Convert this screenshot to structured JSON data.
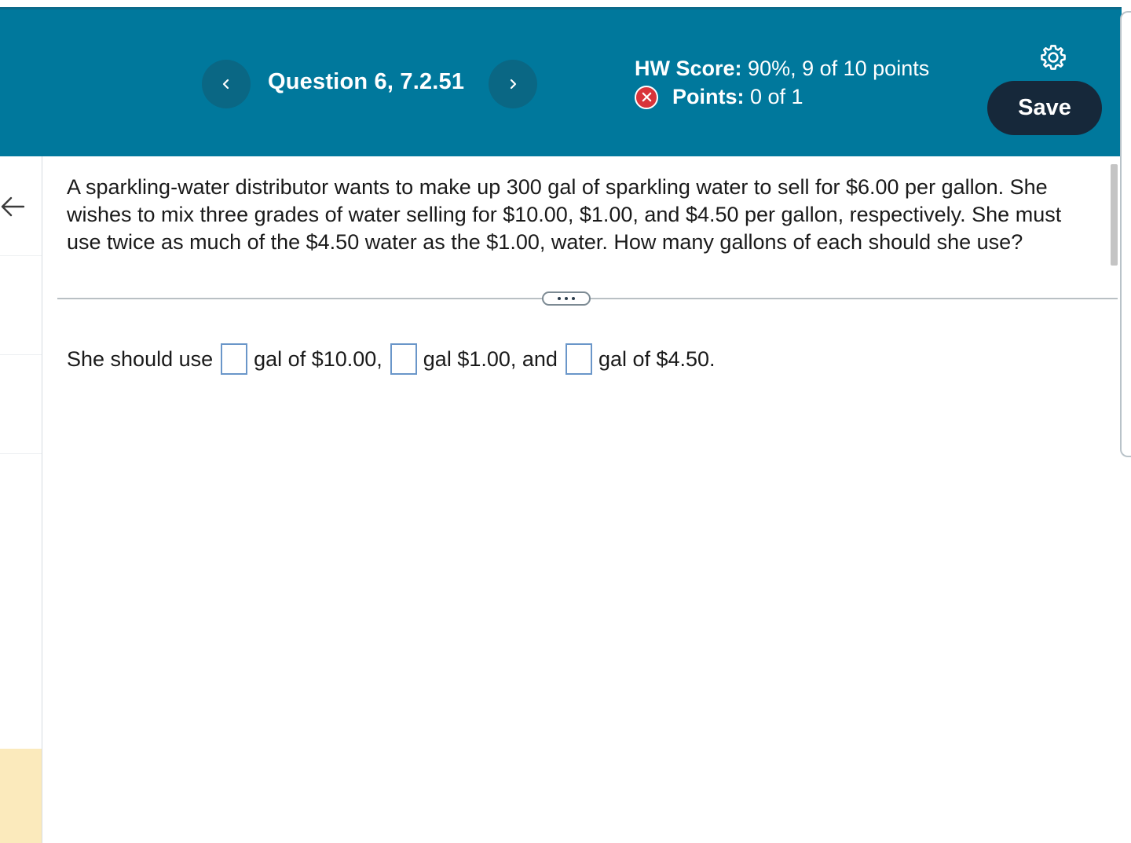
{
  "header": {
    "question_title": "Question 6, 7.2.51",
    "prev_label": "‹",
    "next_label": "›",
    "hw_score_label": "HW Score:",
    "hw_score_value": "90%, 9 of 10 points",
    "points_label": "Points:",
    "points_value": "0 of 1",
    "save_label": "Save",
    "status_color": "#d9343a",
    "brand_color": "#00789c"
  },
  "question": {
    "text": "A sparkling-water distributor wants to make up 300 gal of sparkling water to sell for $6.00 per gallon. She wishes to mix three grades of water selling for $10.00, $1.00, and $4.50 per gallon, respectively. She must use twice as much of the $4.50 water as the $1.00, water. How many gallons of each should she use?"
  },
  "answer": {
    "prefix": "She should use",
    "part1": "gal of $10.00,",
    "part2": "gal $1.00, and",
    "part3": "gal of $4.50.",
    "inputs": [
      "",
      "",
      ""
    ]
  },
  "icons": {
    "back": "arrow-left-icon",
    "settings": "gear-icon",
    "incorrect": "x-circle-icon",
    "more": "ellipsis-icon"
  }
}
